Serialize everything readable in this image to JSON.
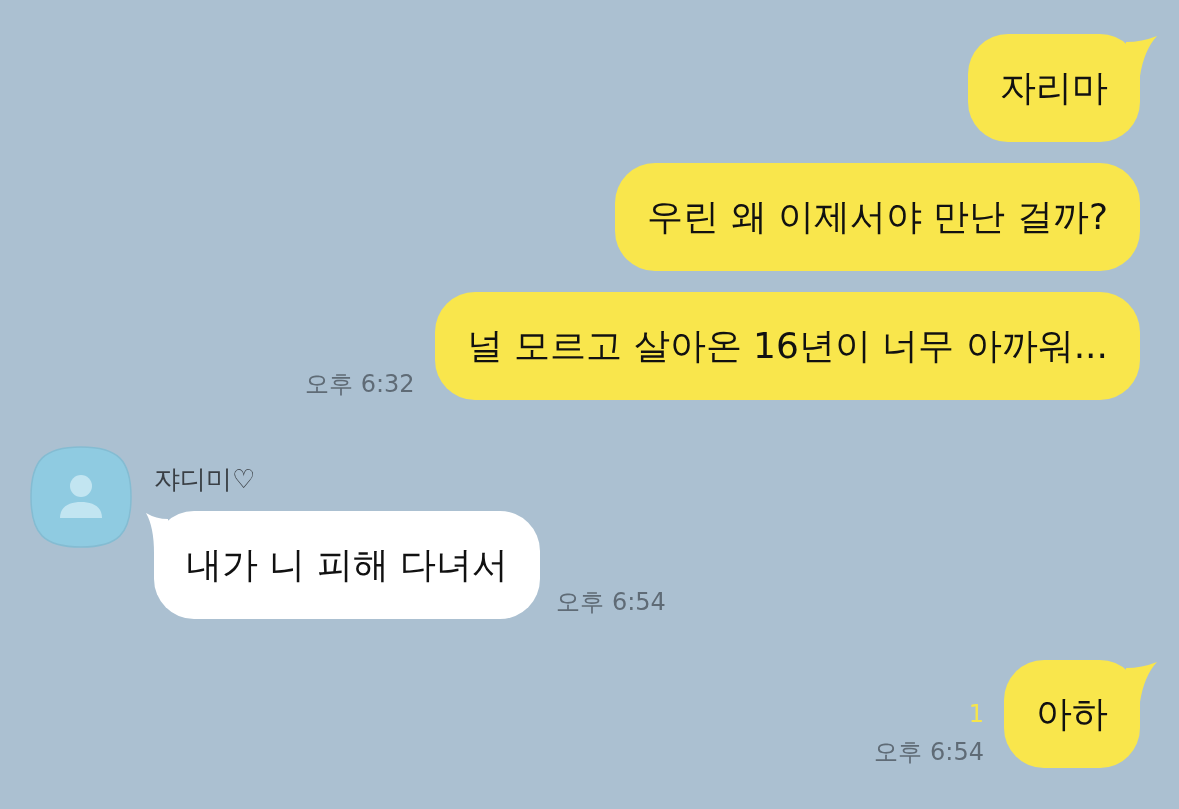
{
  "messages": [
    {
      "kind": "outgoing",
      "bubbles": [
        "자리마",
        "우린 왜 이제서야 만난 걸까?",
        "널 모르고 살아온 16년이 너무 아까워..."
      ],
      "time": "오후 6:32"
    },
    {
      "kind": "incoming",
      "sender": "쟈디미♡",
      "bubbles": [
        "내가 니 피해 다녀서"
      ],
      "time": "오후 6:54"
    },
    {
      "kind": "outgoing",
      "bubbles": [
        "아하"
      ],
      "unread": "1",
      "time": "오후 6:54"
    }
  ]
}
